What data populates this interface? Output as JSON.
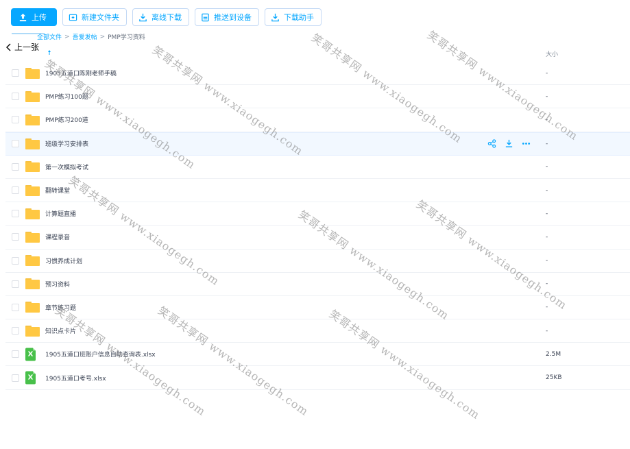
{
  "toolbar": {
    "upload": "上传",
    "new_folder": "新建文件夹",
    "offline_download": "离线下载",
    "push_to_device": "推送到设备",
    "download_helper": "下载助手"
  },
  "breadcrumb": {
    "all_files": "全部文件",
    "folder": "吾爱发帖",
    "current": "PMP学习资料"
  },
  "nav": {
    "prev": "上一张"
  },
  "columns": {
    "size": "大小"
  },
  "files": [
    {
      "name": "1905五道口陈刚老师手稿",
      "type": "folder",
      "size": "-"
    },
    {
      "name": "PMP练习100题",
      "type": "folder",
      "size": "-"
    },
    {
      "name": "PMP练习200道",
      "type": "folder",
      "size": "-"
    },
    {
      "name": "班级学习安排表",
      "type": "folder",
      "size": "-"
    },
    {
      "name": "第一次模拟考试",
      "type": "folder",
      "size": "-"
    },
    {
      "name": "翻转课堂",
      "type": "folder",
      "size": "-"
    },
    {
      "name": "计算题直播",
      "type": "folder",
      "size": "-"
    },
    {
      "name": "课程录音",
      "type": "folder",
      "size": "-"
    },
    {
      "name": "习惯养成计划",
      "type": "folder",
      "size": "-"
    },
    {
      "name": "预习资料",
      "type": "folder",
      "size": "-"
    },
    {
      "name": "章节练习题",
      "type": "folder",
      "size": "-"
    },
    {
      "name": "知识点卡片",
      "type": "folder",
      "size": "-"
    },
    {
      "name": "1905五道口班账户信息自助查询表.xlsx",
      "type": "xlsx",
      "size": "2.5M"
    },
    {
      "name": "1905五道口考号.xlsx",
      "type": "xlsx",
      "size": "25KB"
    }
  ],
  "xlsx_glyph": "X",
  "watermark": "笑哥共享网 www.xiaogegh.com",
  "icons": {
    "upload": "upload-icon",
    "new_folder": "new-folder-icon",
    "offline": "download-icon",
    "push": "push-device-icon",
    "helper": "download-helper-icon",
    "share": "share-icon",
    "download": "download-icon",
    "more": "more-icon"
  },
  "colors": {
    "accent": "#06a7ff",
    "folder": "#ffc843",
    "xlsx": "#48c04a",
    "hover_row": "#f2f8ff"
  }
}
